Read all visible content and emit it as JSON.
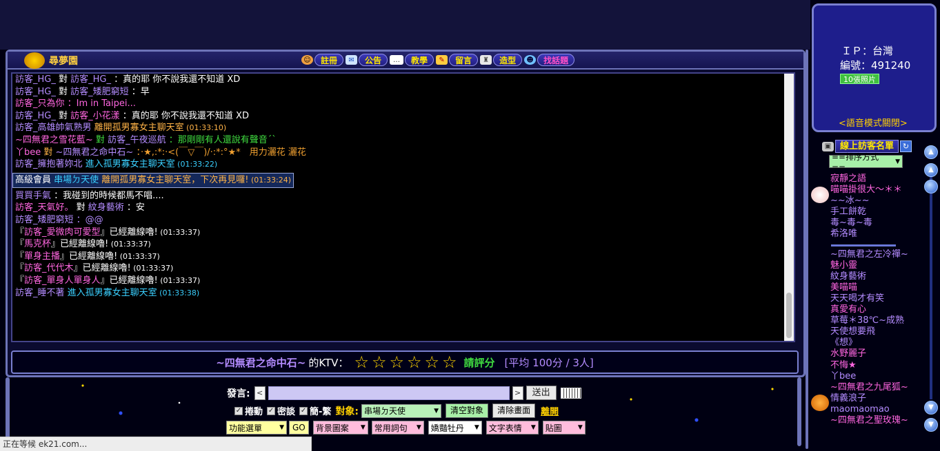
{
  "header": {
    "logo_text": "尋夢園",
    "nav": [
      {
        "label": "註冊",
        "icon": "smiley-icon"
      },
      {
        "label": "公告",
        "icon": "envelope-icon"
      },
      {
        "label": "教學",
        "icon": "speech-bubble-icon"
      },
      {
        "label": "留言",
        "icon": "pencil-icon"
      },
      {
        "label": "造型",
        "icon": "hanger-icon"
      },
      {
        "label": "找話題",
        "icon": "face-icon"
      }
    ]
  },
  "chat": {
    "lines": [
      {
        "a": "訪客_HG_",
        "b": " 對 ",
        "c": "訪客_HG_",
        "d": " ：真的耶 你不說我還不知道 XD"
      },
      {
        "a": "訪客_HG_",
        "b": " 對 ",
        "c": "訪客_矮肥窮短",
        "d": " ：早"
      },
      {
        "a": "訪客_只為你",
        "d": " ：Im in Taipei..."
      },
      {
        "a": "訪客_HG_",
        "b": " 對 ",
        "c": "訪客_小花漾",
        "d": " ：真的耶 你不說我還不知道 XD"
      },
      {
        "a": "訪客_高雄帥氣熟男",
        "d": " 離開孤男寡女主聊天室",
        "t": " (01:33:10)"
      },
      {
        "a": "~四無君之雪花藍~",
        "b": " 對 ",
        "c": "訪客_午夜巡航",
        "d": " ：那剛剛有人還說有聲音´`"
      },
      {
        "a": "丫bee",
        "b": " 對 ",
        "c": "~四無君之命中石~",
        "d": " ：·★,:*:·<(￣▽￣)/·:*:°★*　用力灑花 灑花"
      },
      {
        "a": "訪客_擁抱著妳北",
        "d": " 進入孤男寡女主聊天室",
        "t": " (01:33:22)"
      },
      {
        "a": "高級會員 ",
        "c": "串場ㄉ天使",
        "d": " 離開孤男寡女主聊天室，下次再見囉!",
        "t": " (01:33:24)"
      },
      {
        "a": "買買手氣",
        "d": " ：我碰到的時候都馬不唱...."
      },
      {
        "a": "訪客_天氣好。",
        "b": " 對 ",
        "c": "紋身藝術",
        "d": " ：安"
      },
      {
        "a": "訪客_矮肥窮短",
        "d": " ：@@"
      },
      {
        "pre": "『",
        "a": "訪客_愛微肉可愛型",
        "d": "』已經離線嚕!",
        "t": " (01:33:37)"
      },
      {
        "pre": "『",
        "a": "馬克杯",
        "d": "』已經離線嚕!",
        "t": " (01:33:37)"
      },
      {
        "pre": "『",
        "a": "單身主播",
        "d": "』已經離線嚕!",
        "t": " (01:33:37)"
      },
      {
        "pre": "『",
        "a": "訪客_代代木",
        "d": "』已經離線嚕!",
        "t": " (01:33:37)"
      },
      {
        "pre": "『",
        "a": "訪客_單身人單身人",
        "d": "』已經離線嚕!",
        "t": " (01:33:37)"
      },
      {
        "a": "訪客_睡不著",
        "d": " 進入孤男寡女主聊天室",
        "t": " (01:33:38)"
      }
    ]
  },
  "ktv": {
    "name": "~四無君之命中石~",
    "suffix": "的KTV：",
    "stars": [
      "☆",
      "☆",
      "☆",
      "☆",
      "☆",
      "☆"
    ],
    "rate_label": "請評分",
    "average": "[平均 100分 / 3人]"
  },
  "input": {
    "speak_label": "發言:",
    "left_arrow": "<",
    "right_arrow": ">",
    "send_label": "送出",
    "checks": [
      {
        "label": "捲動",
        "checked": "✓"
      },
      {
        "label": "密談",
        "checked": "✓"
      },
      {
        "label": "簡-繁",
        "checked": "✓"
      }
    ],
    "target_label": "對象:",
    "target_value": "串場ㄉ天使",
    "clear_target": "清空對象",
    "clear_screen": "清除畫面",
    "leave": "離開",
    "func_select": "功能選單",
    "go": "GO",
    "bg_select": "背景圖案",
    "common_select": "常用詞句",
    "color_select": "嬌豔牡丹",
    "emoji_select": "文字表情",
    "sticker_select": "貼圖"
  },
  "info": {
    "ip": "ＩＰ：台灣",
    "number": "編號：491240",
    "photos": "10張照片",
    "voice": "<語音模式關閉>"
  },
  "online": {
    "title": "線上訪客名單",
    "sort": "==排序方式==",
    "users_a": [
      {
        "name": "寂靜之語",
        "color": "pink"
      },
      {
        "name": "喵喵掛很大～＊＊",
        "color": "pink"
      },
      {
        "name": "~~冰~~",
        "color": "purple"
      },
      {
        "name": "手工餅乾",
        "color": "purple"
      },
      {
        "name": "毒~毒~毒",
        "color": "purple"
      },
      {
        "name": "希洛唯",
        "color": "purple"
      }
    ],
    "users_b": [
      {
        "name": "~四無君之左冷禪~",
        "color": "purple"
      },
      {
        "name": "魅小靈",
        "color": "pink"
      },
      {
        "name": "紋身藝術",
        "color": "purple"
      },
      {
        "name": "美喵喵",
        "color": "pink"
      },
      {
        "name": "天天喝才有笑",
        "color": "purple"
      },
      {
        "name": "真愛有心",
        "color": "pink"
      },
      {
        "name": "草莓＊38℃~成熟",
        "color": "purple"
      },
      {
        "name": "天使想要飛",
        "color": "purple"
      },
      {
        "name": "《想》",
        "color": "purple"
      },
      {
        "name": "水野麗子",
        "color": "pink"
      },
      {
        "name": "不悔★",
        "color": "pink"
      },
      {
        "name": "丫bee",
        "color": "purple"
      },
      {
        "name": "~四無君之九尾狐~",
        "color": "pink"
      },
      {
        "name": "情義浪子",
        "color": "purple"
      },
      {
        "name": "maomaomao",
        "color": "purple"
      },
      {
        "name": "~四無君之聖玫瑰~",
        "color": "pink"
      }
    ]
  },
  "status": "正在等候 ek21.com..."
}
